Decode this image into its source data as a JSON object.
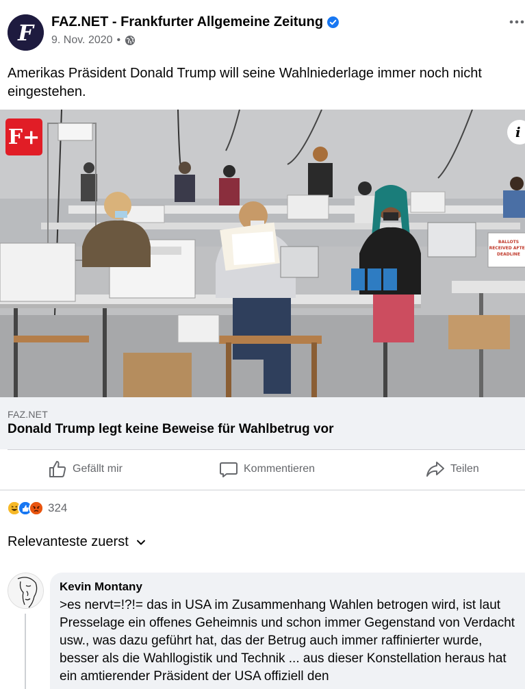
{
  "post": {
    "page_name": "FAZ.NET - Frankfurter Allgemeine Zeitung",
    "date": "9. Nov. 2020",
    "separator": "•",
    "verified_icon": "verified-badge-icon",
    "privacy_icon": "globe-icon",
    "more_icon": "more-options-icon",
    "text": "Amerikas Präsident Donald Trump will seine Wahlniederlage immer noch nicht eingestehen."
  },
  "image": {
    "badge_label": "F+",
    "info_label": "i",
    "sign_text": "BALLOTS RECEIVED AFTER DEADLINE"
  },
  "link": {
    "domain": "FAZ.NET",
    "title": "Donald Trump legt keine Beweise für Wahlbetrug vor"
  },
  "actions": {
    "like": "Gefällt mir",
    "comment": "Kommentieren",
    "share": "Teilen"
  },
  "reactions": {
    "types": [
      "haha",
      "like",
      "angry"
    ],
    "count": "324"
  },
  "comments": {
    "sort_label": "Relevanteste zuerst",
    "items": [
      {
        "author": "Kevin Montany",
        "text": ">es nervt=!?!= das in USA im Zusammenhang Wahlen betrogen wird, ist laut Presselage ein offenes Geheimnis und schon immer Gegenstand von Verdacht usw., was dazu geführt hat, das der Betrug auch immer raffinierter wurde, besser als die Wahllogistik und  Technik ... aus dieser Konstellation heraus hat ein amtierender Präsident der USA offiziell den"
      }
    ]
  },
  "colors": {
    "accent": "#1877f2",
    "secondary_text": "#65676b",
    "faz_red": "#e11d26"
  }
}
